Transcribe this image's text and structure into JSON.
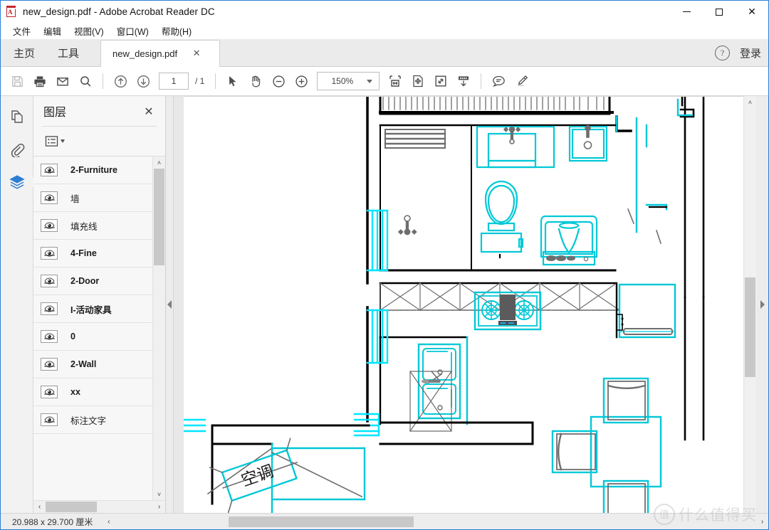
{
  "window": {
    "title": "new_design.pdf - Adobe Acrobat Reader DC",
    "app_icon": "pdf-file-icon",
    "minimize_label": "—",
    "maximize_label": "□",
    "close_label": "✕"
  },
  "menubar": {
    "items": [
      {
        "label": "文件",
        "name": "menu-file"
      },
      {
        "label": "编辑",
        "name": "menu-edit"
      },
      {
        "label": "视图(V)",
        "name": "menu-view"
      },
      {
        "label": "窗口(W)",
        "name": "menu-window"
      },
      {
        "label": "帮助(H)",
        "name": "menu-help"
      }
    ]
  },
  "tabstrip": {
    "home_label": "主页",
    "tools_label": "工具",
    "doc_tab_label": "new_design.pdf",
    "doc_tab_close": "✕",
    "help_label": "?",
    "signin_label": "登录"
  },
  "toolbar": {
    "buttons": [
      {
        "name": "save-button",
        "icon": "save-icon",
        "disabled": true
      },
      {
        "name": "print-button",
        "icon": "print-icon",
        "disabled": false
      },
      {
        "name": "email-button",
        "icon": "envelope-icon",
        "disabled": false
      },
      {
        "name": "search-button",
        "icon": "search-icon",
        "disabled": false
      },
      {
        "name": "previous-page-button",
        "icon": "arrow-up-circle-icon",
        "disabled": false
      },
      {
        "name": "next-page-button",
        "icon": "arrow-down-circle-icon",
        "disabled": false
      }
    ],
    "page_number": "1",
    "page_total": "/ 1",
    "select_tool": "cursor-icon",
    "hand_tool": "hand-icon",
    "zoom_out": "minus-circle-icon",
    "zoom_in": "plus-circle-icon",
    "zoom_value": "150%",
    "fit_width": "fit-width-icon",
    "fit_page": "fit-page-icon",
    "fullscreen": "expand-icon",
    "scroll_mode": "scroll-down-icon",
    "comment": "comment-bubble-icon",
    "highlight": "highlighter-pen-icon"
  },
  "navrail": {
    "items": [
      {
        "name": "sidebar-thumbnails",
        "icon": "page-thumbnails-icon",
        "active": false
      },
      {
        "name": "sidebar-attachments",
        "icon": "paperclip-icon",
        "active": false
      },
      {
        "name": "sidebar-layers",
        "icon": "layers-icon",
        "active": true
      }
    ]
  },
  "layers_panel": {
    "title": "图层",
    "close_label": "✕",
    "options_icon": "list-options-icon",
    "layers": [
      {
        "label": "2-Furniture",
        "bold": true,
        "visible": true
      },
      {
        "label": "墙",
        "bold": false,
        "visible": true
      },
      {
        "label": "填充线",
        "bold": false,
        "visible": true
      },
      {
        "label": "4-Fine",
        "bold": true,
        "visible": true
      },
      {
        "label": "2-Door",
        "bold": true,
        "visible": true
      },
      {
        "label": "I-活动家具",
        "bold": true,
        "visible": true
      },
      {
        "label": "0",
        "bold": true,
        "visible": true
      },
      {
        "label": "2-Wall",
        "bold": true,
        "visible": true
      },
      {
        "label": "xx",
        "bold": true,
        "visible": true
      },
      {
        "label": "标注文字",
        "bold": false,
        "visible": true
      }
    ],
    "scroll_up": "˄",
    "scroll_down": "˅",
    "scroll_left": "‹",
    "scroll_right": "›"
  },
  "splitters": {
    "left_collapse": "collapse-left-arrow-icon",
    "right_collapse": "collapse-right-arrow-icon"
  },
  "document": {
    "annotation_label": "空调",
    "colors": {
      "cyan": "#00c8d7",
      "bright_cyan": "#00e5ff",
      "black": "#000000",
      "gray": "#6e6e6e"
    }
  },
  "statusbar": {
    "dimensions": "20.988 x 29.700 厘米",
    "scroll_left": "‹",
    "scroll_right": "›"
  },
  "watermark": {
    "logo": "值",
    "text": "什么值得买"
  }
}
